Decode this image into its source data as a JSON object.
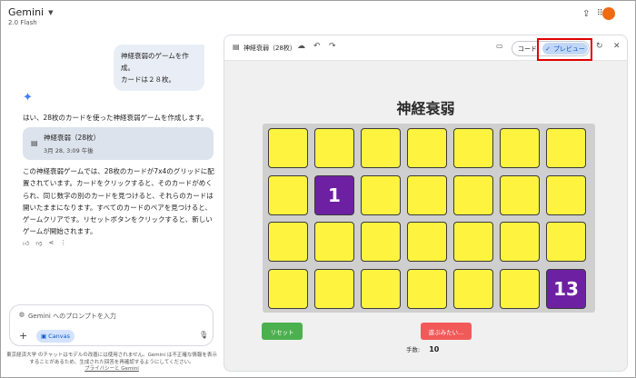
{
  "header": {
    "app_name": "Gemini",
    "model": "2.0 Flash",
    "share_icon": "share-icon",
    "apps_icon": "apps-grid-icon",
    "avatar_color": "#ee6a13"
  },
  "chat": {
    "user_message_line1": "神経衰弱のゲームを作成。",
    "user_message_line2": "カードは２８枚。",
    "reply_intro": "はい、28枚のカードを使った神経衰弱ゲームを作成します。",
    "doc_card": {
      "title": "神経衰弱（28枚）",
      "date": "3月 28, 3:09 午後"
    },
    "reply_paragraph": "この神経衰弱ゲームでは、28枚のカードが7x4のグリッドに配置されています。カードをクリックすると、そのカードがめくられ、同じ数字の別のカードを見つけると、それらのカードは開いたままになります。すべてのカードのペアを見つけると、ゲームクリアです。リセットボタンをクリックすると、新しいゲームが開始されます。",
    "feedback_icons": [
      "thumb-up-icon",
      "thumb-down-icon",
      "share-icon",
      "more-vert-icon"
    ]
  },
  "prompt": {
    "placeholder": "Gemini へのプロンプトを入力",
    "canvas_label": "Canvas",
    "disclaimer_line1": "東京経済大学 のチャットはモデルの改善には使用されません。Gemini は不正確な情報を表示",
    "disclaimer_line2": "することがあるため、生成された回答を再確認するようにしてください。",
    "privacy_link": "プライバシーと Gemini"
  },
  "canvas": {
    "title": "神経衰弱（28枚）",
    "code_label": "コード",
    "preview_label": "プレビュー",
    "highlight_color": "#e00000"
  },
  "game": {
    "title": "神経衰弱",
    "rows": 4,
    "cols": 7,
    "card_color": "#fef33f",
    "flipped_color": "#6e20a3",
    "flipped": [
      {
        "row": 1,
        "col": 1,
        "value": "1"
      },
      {
        "row": 3,
        "col": 6,
        "value": "13"
      }
    ],
    "reset_label": "リセット",
    "retry_label": "遊ぶみたい...",
    "moves_label": "手数:",
    "moves_value": "10"
  }
}
